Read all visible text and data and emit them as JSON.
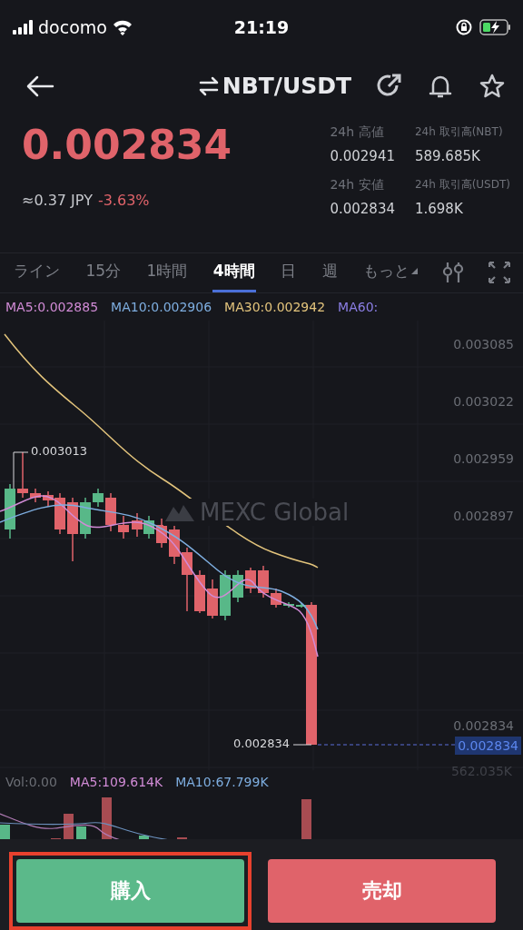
{
  "status_bar": {
    "carrier": "docomo",
    "time": "21:19"
  },
  "header": {
    "title": "NBT/USDT"
  },
  "ticker": {
    "price": "0.002834",
    "fiat": "≈0.37 JPY",
    "change": "-3.63%",
    "stats": [
      {
        "label": "24h 高値",
        "value": "0.002941"
      },
      {
        "label": "24h 取引高(NBT)",
        "value": "589.685K"
      },
      {
        "label": "24h 安値",
        "value": "0.002834"
      },
      {
        "label": "24h 取引高(USDT)",
        "value": "1.698K"
      }
    ]
  },
  "tabs": [
    {
      "label": "ライン",
      "selected": false
    },
    {
      "label": "15分",
      "selected": false
    },
    {
      "label": "1時間",
      "selected": false
    },
    {
      "label": "4時間",
      "selected": true
    },
    {
      "label": "日",
      "selected": false
    },
    {
      "label": "週",
      "selected": false
    },
    {
      "label": "もっと",
      "selected": false
    }
  ],
  "legend": [
    {
      "text": "MA5:0.002885",
      "color": "#d18bd6"
    },
    {
      "text": "MA10:0.002906",
      "color": "#7eaee0"
    },
    {
      "text": "MA30:0.002942",
      "color": "#e3c47c"
    },
    {
      "text": "MA60:",
      "color": "#8c7fe6"
    }
  ],
  "chart": {
    "axis_labels": [
      "0.003085",
      "0.003022",
      "0.002959",
      "0.002897",
      "0.002834"
    ],
    "high_label": "0.003013",
    "low_label": "0.002834",
    "last_price": "0.002834",
    "watermark": "MEXC Global"
  },
  "volume": {
    "legend": [
      {
        "text": "Vol:0.00",
        "color": "#6b6e75"
      },
      {
        "text": "MA5:109.614K",
        "color": "#d18bd6"
      },
      {
        "text": "MA10:67.799K",
        "color": "#7eaee0"
      }
    ],
    "max_label": "562.035K"
  },
  "buttons": [
    {
      "label": "購入",
      "kind": "buy",
      "highlighted": true
    },
    {
      "label": "売却",
      "kind": "sell",
      "highlighted": false
    }
  ]
}
